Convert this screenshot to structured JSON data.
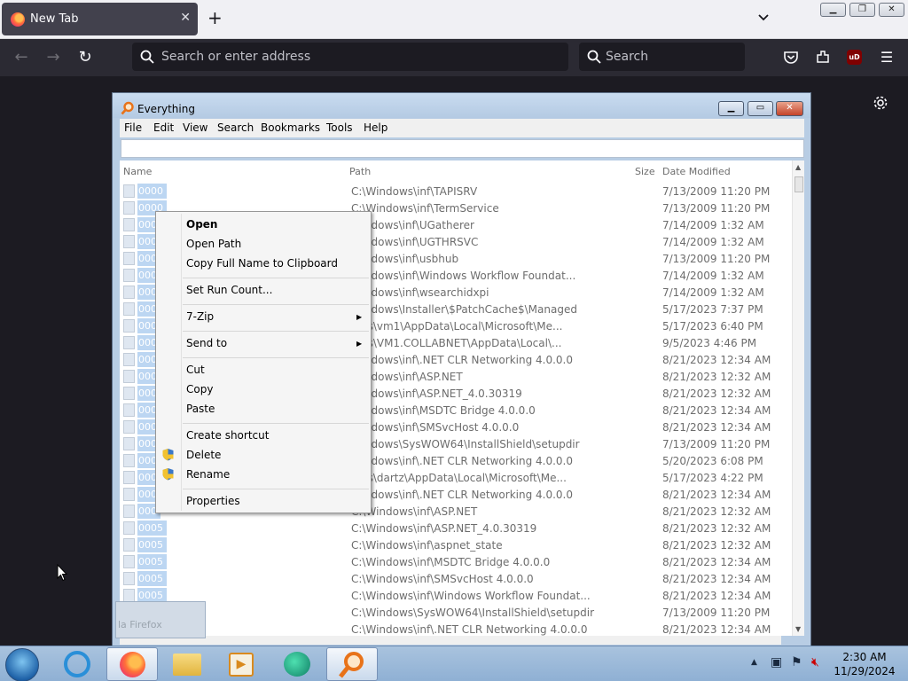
{
  "browser": {
    "tab_title": "New Tab",
    "url_placeholder": "Search or enter address",
    "search_placeholder": "Search"
  },
  "everything": {
    "title": "Everything",
    "menu": [
      "File",
      "Edit",
      "View",
      "Search",
      "Bookmarks",
      "Tools",
      "Help"
    ],
    "columns": {
      "name": "Name",
      "path": "Path",
      "size": "Size",
      "date": "Date Modified"
    },
    "rows": [
      {
        "name": "0000",
        "path": "C:\\Windows\\inf\\TAPISRV",
        "date": "7/13/2009 11:20 PM"
      },
      {
        "name": "0000",
        "path": "C:\\Windows\\inf\\TermService",
        "date": "7/13/2009 11:20 PM"
      },
      {
        "name": "000",
        "path": "Windows\\inf\\UGatherer",
        "date": "7/14/2009 1:32 AM"
      },
      {
        "name": "000",
        "path": "Windows\\inf\\UGTHRSVC",
        "date": "7/14/2009 1:32 AM"
      },
      {
        "name": "000",
        "path": "Windows\\inf\\usbhub",
        "date": "7/13/2009 11:20 PM"
      },
      {
        "name": "000",
        "path": "Windows\\inf\\Windows Workflow Foundat...",
        "date": "7/14/2009 1:32 AM"
      },
      {
        "name": "000",
        "path": "Windows\\inf\\wsearchidxpi",
        "date": "7/14/2009 1:32 AM"
      },
      {
        "name": "000",
        "path": "Windows\\Installer\\$PatchCache$\\Managed",
        "date": "5/17/2023 7:37 PM"
      },
      {
        "name": "000",
        "path": "sers\\vm1\\AppData\\Local\\Microsoft\\Me...",
        "date": "5/17/2023 6:40 PM"
      },
      {
        "name": "000",
        "path": "sers\\VM1.COLLABNET\\AppData\\Local\\...",
        "date": "9/5/2023 4:46 PM"
      },
      {
        "name": "000",
        "path": "Windows\\inf\\.NET CLR Networking 4.0.0.0",
        "date": "8/21/2023 12:34 AM"
      },
      {
        "name": "000",
        "path": "Windows\\inf\\ASP.NET",
        "date": "8/21/2023 12:32 AM"
      },
      {
        "name": "000",
        "path": "Windows\\inf\\ASP.NET_4.0.30319",
        "date": "8/21/2023 12:32 AM"
      },
      {
        "name": "000",
        "path": "Windows\\inf\\MSDTC Bridge 4.0.0.0",
        "date": "8/21/2023 12:34 AM"
      },
      {
        "name": "000",
        "path": "Windows\\inf\\SMSvcHost 4.0.0.0",
        "date": "8/21/2023 12:34 AM"
      },
      {
        "name": "000",
        "path": "Windows\\SysWOW64\\InstallShield\\setupdir",
        "date": "7/13/2009 11:20 PM"
      },
      {
        "name": "000",
        "path": "Windows\\inf\\.NET CLR Networking 4.0.0.0",
        "date": "5/20/2023 6:08 PM"
      },
      {
        "name": "000",
        "path": "sers\\dartz\\AppData\\Local\\Microsoft\\Me...",
        "date": "5/17/2023 4:22 PM"
      },
      {
        "name": "000",
        "path": "Windows\\inf\\.NET CLR Networking 4.0.0.0",
        "date": "8/21/2023 12:34 AM"
      },
      {
        "name": "000",
        "path": "C:\\Windows\\inf\\ASP.NET",
        "date": "8/21/2023 12:32 AM"
      },
      {
        "name": "0005",
        "path": "C:\\Windows\\inf\\ASP.NET_4.0.30319",
        "date": "8/21/2023 12:32 AM"
      },
      {
        "name": "0005",
        "path": "C:\\Windows\\inf\\aspnet_state",
        "date": "8/21/2023 12:32 AM"
      },
      {
        "name": "0005",
        "path": "C:\\Windows\\inf\\MSDTC Bridge 4.0.0.0",
        "date": "8/21/2023 12:34 AM"
      },
      {
        "name": "0005",
        "path": "C:\\Windows\\inf\\SMSvcHost 4.0.0.0",
        "date": "8/21/2023 12:34 AM"
      },
      {
        "name": "0005",
        "path": "C:\\Windows\\inf\\Windows Workflow Foundat...",
        "date": "8/21/2023 12:34 AM"
      },
      {
        "name": "",
        "path": "C:\\Windows\\SysWOW64\\InstallShield\\setupdir",
        "date": "7/13/2009 11:20 PM"
      },
      {
        "name": "",
        "path": "C:\\Windows\\inf\\.NET CLR Networking 4.0.0.0",
        "date": "8/21/2023 12:34 AM"
      }
    ]
  },
  "context_menu": {
    "open": "Open",
    "open_path": "Open Path",
    "copy_full_name": "Copy Full Name to Clipboard",
    "set_run_count": "Set Run Count...",
    "seven_zip": "7-Zip",
    "send_to": "Send to",
    "cut": "Cut",
    "copy": "Copy",
    "paste": "Paste",
    "create_shortcut": "Create shortcut",
    "delete": "Delete",
    "rename": "Rename",
    "properties": "Properties"
  },
  "preview_text": "la Firefox",
  "clock": {
    "time": "2:30 AM",
    "date": "11/29/2024"
  },
  "colors": {
    "browser_dark": "#1c1b22",
    "toolbar": "#2b2a33",
    "selection": "#bcd6f2",
    "taskbar": "#a9c3de"
  }
}
